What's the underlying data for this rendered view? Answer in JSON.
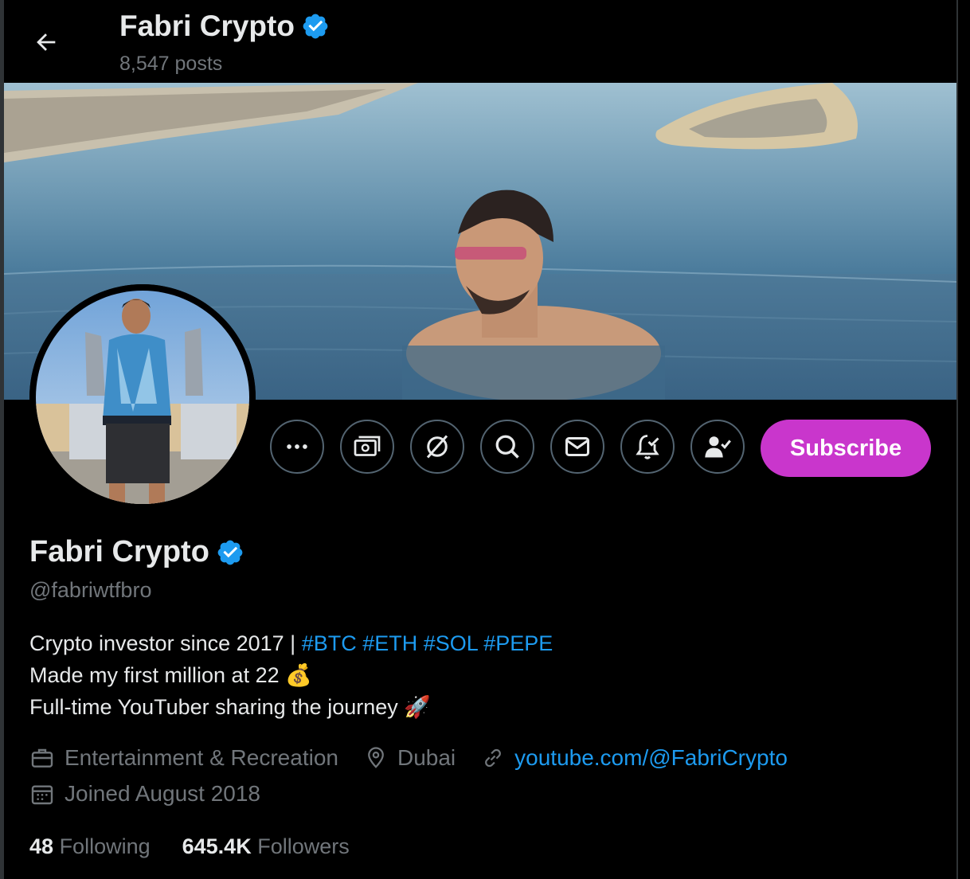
{
  "header": {
    "title": "Fabri Crypto",
    "posts": "8,547 posts"
  },
  "profile": {
    "name": "Fabri Crypto",
    "handle": "@fabriwtfbro",
    "subscribe_label": "Subscribe",
    "bio": {
      "line1_text": "Crypto investor since 2017 | ",
      "line1_tags": "#BTC #ETH #SOL #PEPE",
      "line2": "Made my first million at 22 💰",
      "line3": "Full-time YouTuber sharing the journey 🚀"
    },
    "category": "Entertainment & Recreation",
    "location": "Dubai",
    "website": "youtube.com/@FabriCrypto",
    "joined": "Joined August 2018",
    "following_count": "48",
    "following_label": "Following",
    "followers_count": "645.4K",
    "followers_label": "Followers"
  },
  "actions": [
    "more-icon",
    "money-icon",
    "grok-icon",
    "search-icon",
    "message-icon",
    "notification-icon",
    "following-icon"
  ],
  "colors": {
    "accent": "#1d9bf0",
    "subscribe": "#c936cc",
    "muted": "#71767b",
    "text": "#e7e9ea"
  }
}
